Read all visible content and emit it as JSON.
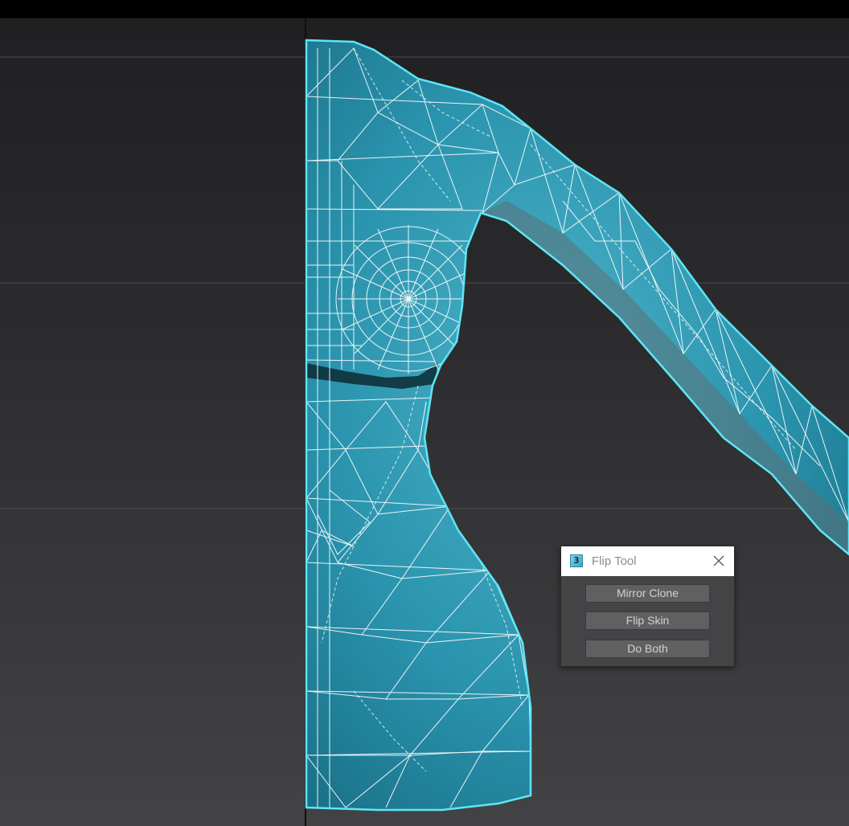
{
  "dialog": {
    "app_icon_glyph": "3",
    "title": "Flip Tool",
    "close_icon": "close-x-icon",
    "buttons": {
      "mirror_clone": "Mirror Clone",
      "flip_skin": "Flip Skin",
      "do_both": "Do Both"
    }
  },
  "colors": {
    "mesh_fill": "#2a93ad",
    "selection_outline": "#5fe6f5",
    "wireframe": "#ffffff",
    "viewport_bg": "#2b2b2d",
    "dialog_bg": "#444446"
  }
}
